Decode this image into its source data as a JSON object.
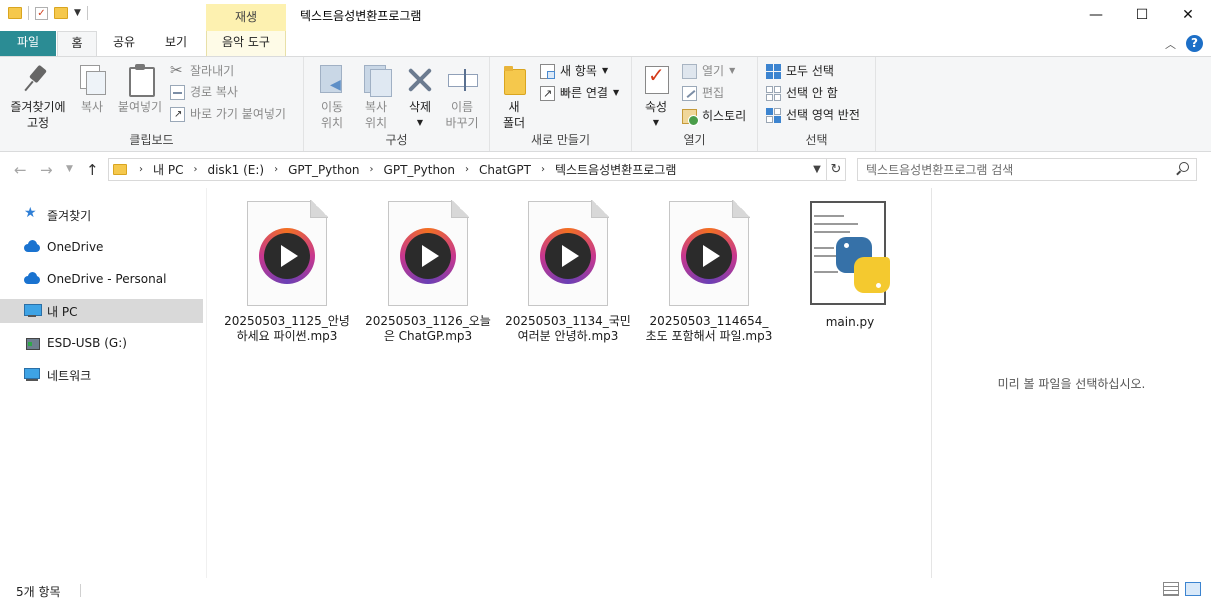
{
  "window": {
    "title": "텍스트음성변환프로그램",
    "contextual_tab_header": "재생",
    "minimize_glyph": "—",
    "maximize_glyph": "☐",
    "close_glyph": "✕"
  },
  "ribbon_tabs": [
    {
      "label": "파일"
    },
    {
      "label": "홈"
    },
    {
      "label": "공유"
    },
    {
      "label": "보기"
    },
    {
      "label": "음악 도구"
    }
  ],
  "ribbon": {
    "help_label": "?",
    "clipboard": {
      "group_label": "클립보드",
      "pin_label_1": "즐겨찾기에",
      "pin_label_2": "고정",
      "copy_label": "복사",
      "paste_label": "붙여넣기",
      "cut_label": "잘라내기",
      "copy_path_label": "경로 복사",
      "paste_shortcut_label": "바로 가기 붙여넣기"
    },
    "organize": {
      "group_label": "구성",
      "move_to_1": "이동",
      "move_to_2": "위치",
      "copy_to_1": "복사",
      "copy_to_2": "위치",
      "delete_label": "삭제",
      "rename_1": "이름",
      "rename_2": "바꾸기"
    },
    "new": {
      "group_label": "새로 만들기",
      "new_folder_1": "새",
      "new_folder_2": "폴더",
      "new_item_label": "새 항목",
      "easy_access_label": "빠른 연결"
    },
    "open": {
      "group_label": "열기",
      "properties_label": "속성",
      "open_label": "열기",
      "edit_label": "편집",
      "history_label": "히스토리"
    },
    "select": {
      "group_label": "선택",
      "select_all_label": "모두 선택",
      "select_none_label": "선택 안 함",
      "invert_label": "선택 영역 반전"
    }
  },
  "address_bar": {
    "breadcrumbs": [
      "내 PC",
      "disk1 (E:)",
      "GPT_Python",
      "GPT_Python",
      "ChatGPT",
      "텍스트음성변환프로그램"
    ],
    "search_placeholder": "텍스트음성변환프로그램 검색"
  },
  "nav_pane": {
    "items": [
      {
        "label": "즐겨찾기",
        "icon": "star-icon"
      },
      {
        "label": "OneDrive",
        "icon": "cloud-icon"
      },
      {
        "label": "OneDrive - Personal",
        "icon": "cloud-icon"
      },
      {
        "label": "내 PC",
        "icon": "pc-icon",
        "selected": true
      },
      {
        "label": "ESD-USB (G:)",
        "icon": "usb-icon"
      },
      {
        "label": "네트워크",
        "icon": "network-icon"
      }
    ]
  },
  "files": [
    {
      "name": "20250503_1125_안녕하세요 파이썬.mp3",
      "type": "mp3"
    },
    {
      "name": "20250503_1126_오늘은 ChatGP.mp3",
      "type": "mp3"
    },
    {
      "name": "20250503_1134_국민 여러분 안녕하.mp3",
      "type": "mp3"
    },
    {
      "name": "20250503_114654_초도 포함해서 파일.mp3",
      "type": "mp3"
    },
    {
      "name": "main.py",
      "type": "python"
    }
  ],
  "preview_pane": {
    "message": "미리 볼 파일을 선택하십시오."
  },
  "status_bar": {
    "item_count": "5개 항목"
  },
  "colors": {
    "file_tab": "#2b8c94",
    "contextual_tab": "#fdf1b0",
    "selection": "#d9d9d9",
    "help_blue": "#1d6fc7"
  }
}
